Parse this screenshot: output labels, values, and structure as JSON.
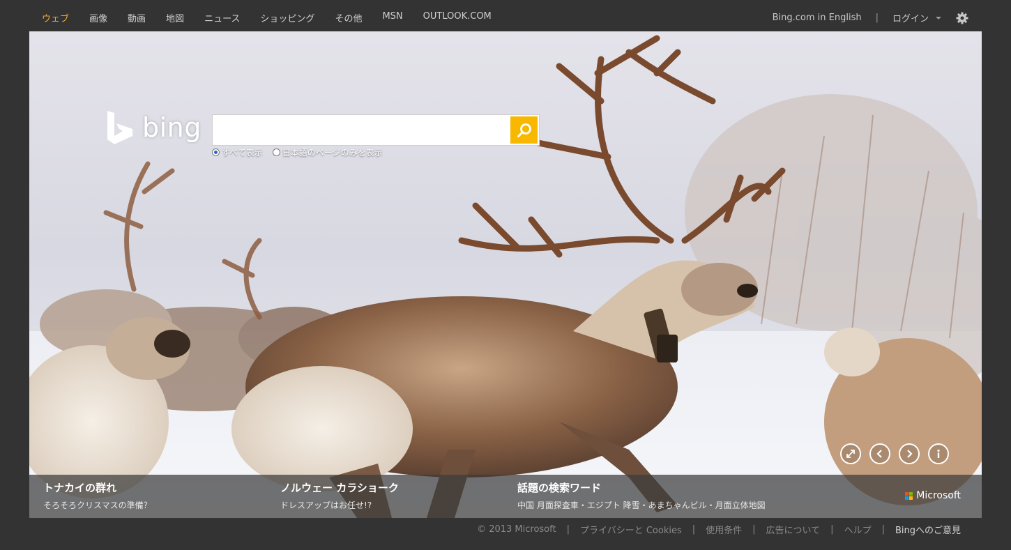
{
  "nav": {
    "items": [
      "ウェブ",
      "画像",
      "動画",
      "地図",
      "ニュース",
      "ショッピング",
      "その他",
      "MSN",
      "OUTLOOK.COM"
    ],
    "active_color": "#f0a830"
  },
  "header_right": {
    "english": "Bing.com in English",
    "separator": "|",
    "login": "ログイン",
    "settings_icon": "gear-icon"
  },
  "logo": {
    "word": "bing",
    "mark_icon": "bing-logo-icon"
  },
  "search": {
    "value": "",
    "placeholder": "",
    "button_icon": "search-icon",
    "button_color": "#f8b800"
  },
  "scope": {
    "all": "すべて表示",
    "japanese_only": "日本語のページのみを表示",
    "selected": "all"
  },
  "controls": [
    "expand-icon",
    "chevron-left-icon",
    "chevron-right-icon",
    "info-icon"
  ],
  "hotspots": [
    {
      "title": "トナカイの群れ",
      "subtitle": "そろそろクリスマスの準備？"
    },
    {
      "title": "ノルウェー カラショーク",
      "subtitle": "ドレスアップはお任せ!?"
    },
    {
      "title": "話題の検索ワード",
      "subtitle": "中国 月面探査車・エジプト 降雪・あまちゃんビル・月面立体地図"
    }
  ],
  "brand": {
    "name": "Microsoft",
    "colors": [
      "#f25022",
      "#7fba00",
      "#00a4ef",
      "#ffb900"
    ]
  },
  "footer": {
    "copyright": "© 2013 Microsoft",
    "privacy": "プライバシーと Cookies",
    "terms": "使用条件",
    "ads": "広告について",
    "help": "ヘルプ",
    "feedback": "Bingへのご意見",
    "separator": "|"
  }
}
